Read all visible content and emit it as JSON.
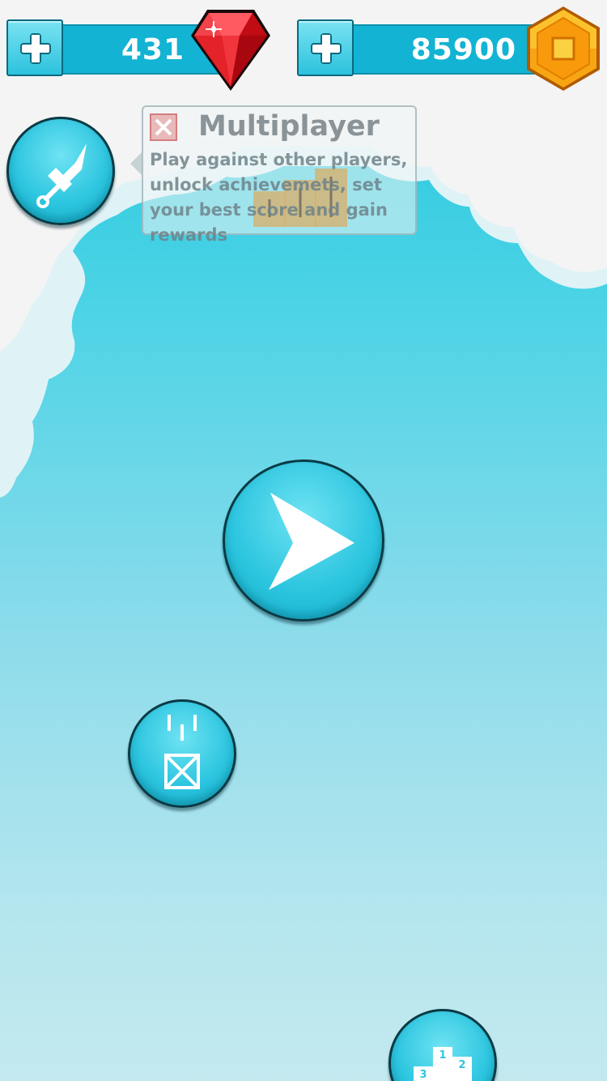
{
  "currency": {
    "gems": "431",
    "coins": "85900"
  },
  "tooltip": {
    "title": "Multiplayer",
    "body": "Play against other players, unlock achievemets, set your best score and gain rewards"
  },
  "icons": {
    "add_gems": "plus-icon",
    "gem": "ruby-gem-icon",
    "add_coins": "plus-icon",
    "coin": "hexagon-coin-icon",
    "multiplayer": "sword-icon",
    "play": "play-triangle-icon",
    "powerup": "falling-crate-icon",
    "leaderboard": "podium-icon",
    "close": "close-x-icon"
  },
  "leaderboard_podium_labels": [
    "1",
    "2",
    "3"
  ],
  "colors": {
    "sky_top": "#1ec5dc",
    "sky_bottom": "#c3e9ef",
    "bar": "#12b3d3",
    "button": "#2ec6e0",
    "gem_red": "#e0141c",
    "coin_orange": "#f7a513"
  }
}
